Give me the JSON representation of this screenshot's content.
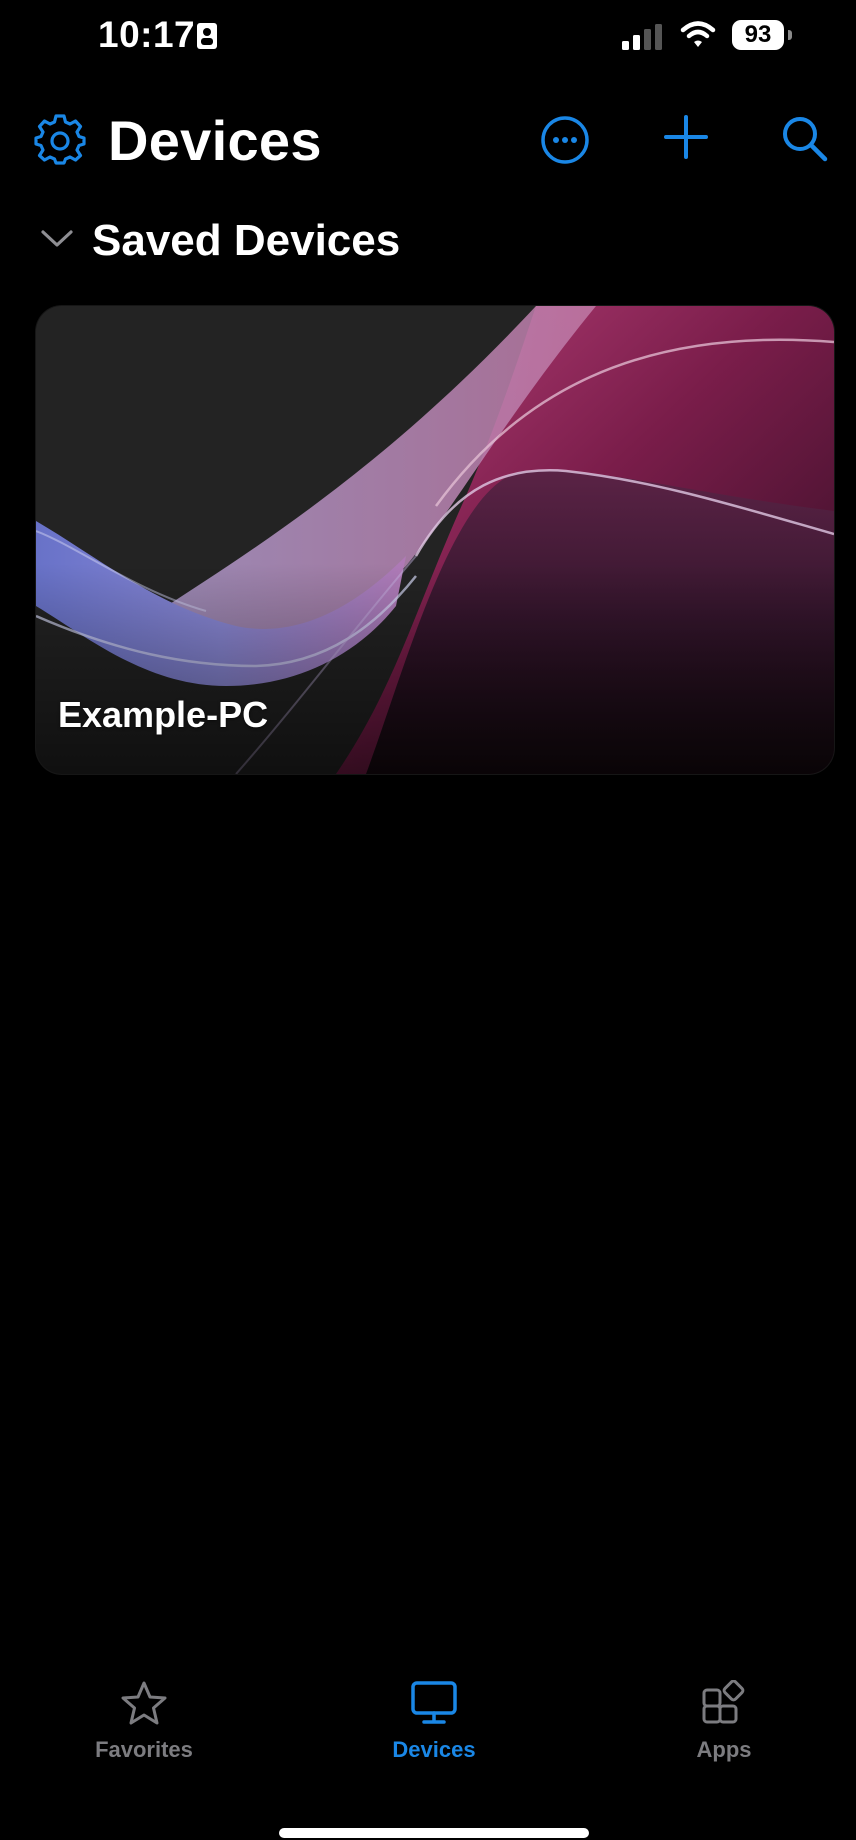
{
  "status_bar": {
    "time": "10:17",
    "battery": "93"
  },
  "header": {
    "title": "Devices"
  },
  "section": {
    "title": "Saved Devices"
  },
  "devices": [
    {
      "name": "Example-PC"
    }
  ],
  "tab_bar": {
    "tabs": [
      {
        "label": "Favorites",
        "icon": "star-icon"
      },
      {
        "label": "Devices",
        "icon": "monitor-icon",
        "selected": true
      },
      {
        "label": "Apps",
        "icon": "apps-icon"
      }
    ]
  },
  "colors": {
    "accent": "#1a87e6",
    "background": "#000000",
    "inactive_tab": "#7c7c80"
  }
}
